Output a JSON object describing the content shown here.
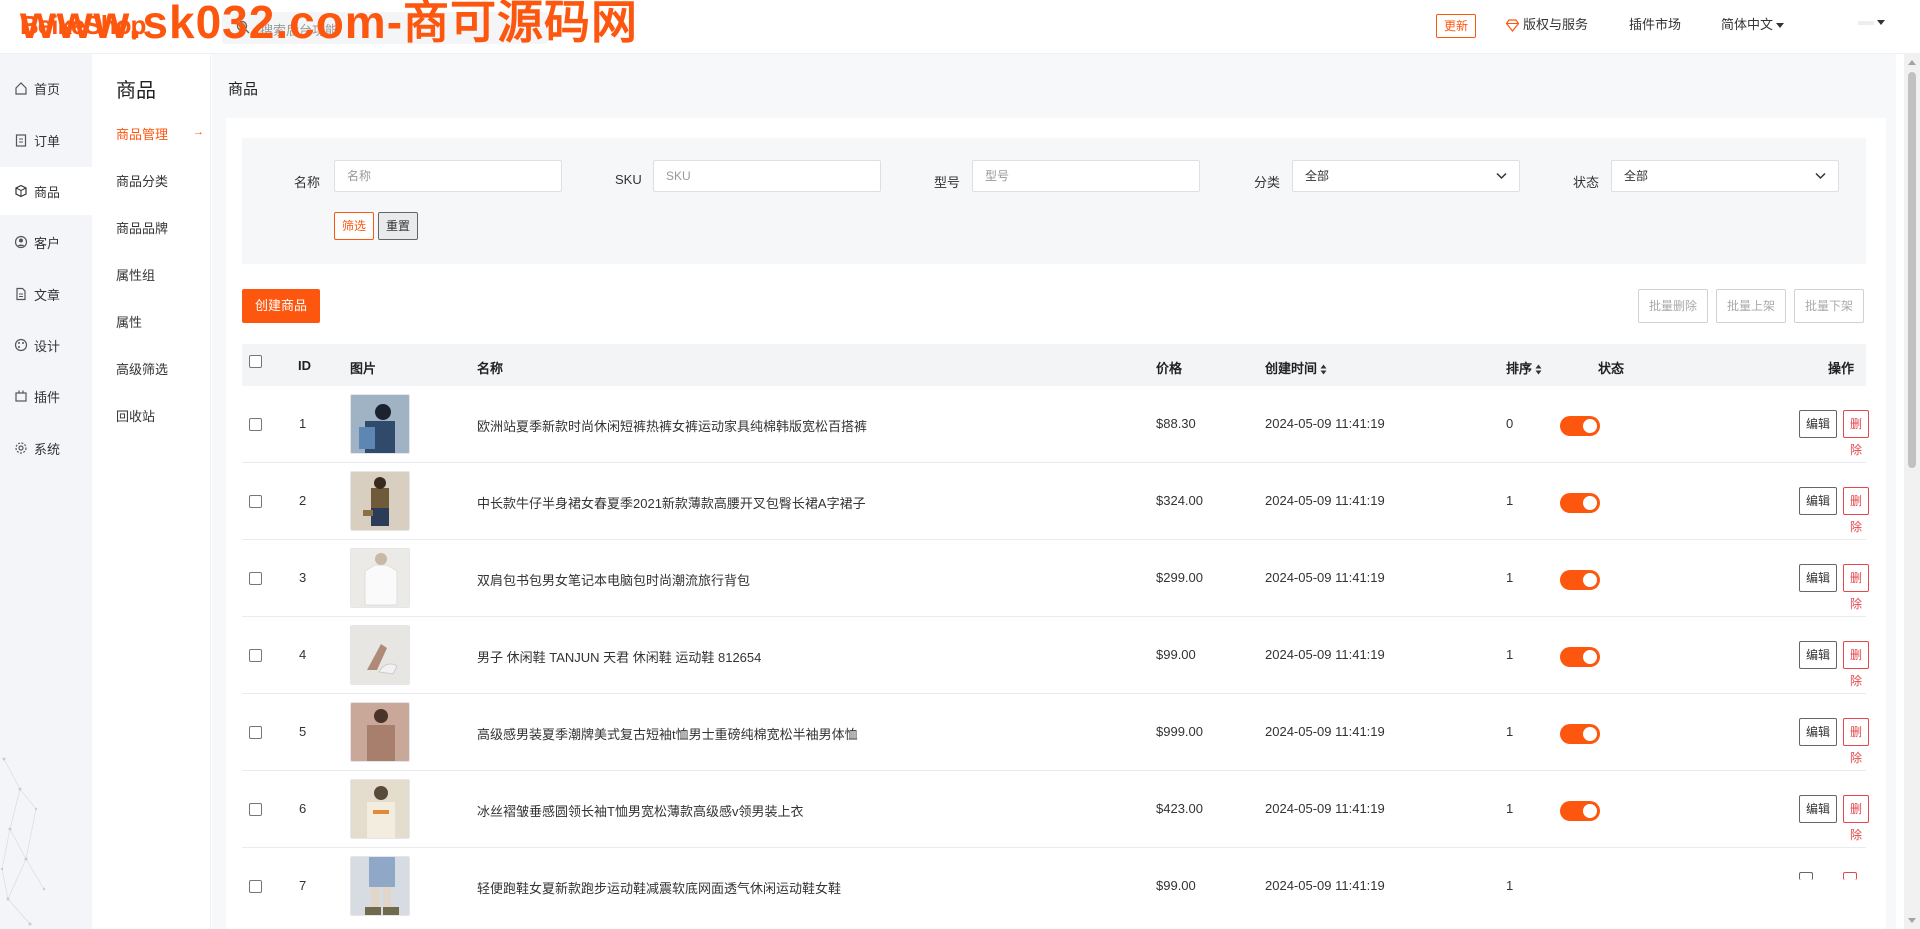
{
  "header": {
    "logo": "BeikeShop",
    "watermark": "www.sk032.com-商可源码网",
    "search_placeholder": "搜索后台功能",
    "update_label": "更新",
    "copyright_label": "版权与服务",
    "plugin_market_label": "插件市场",
    "language_label": "简体中文",
    "brand_color": "#fd560f"
  },
  "sidebar": {
    "items": [
      {
        "label": "首页",
        "icon": "home-icon"
      },
      {
        "label": "订单",
        "icon": "clipboard-icon"
      },
      {
        "label": "商品",
        "icon": "box-icon"
      },
      {
        "label": "客户",
        "icon": "user-circle-icon"
      },
      {
        "label": "文章",
        "icon": "document-icon"
      },
      {
        "label": "设计",
        "icon": "palette-icon"
      },
      {
        "label": "插件",
        "icon": "plugin-icon"
      },
      {
        "label": "系统",
        "icon": "gear-icon"
      }
    ],
    "active": "商品"
  },
  "subnav": {
    "title": "商品",
    "items": [
      "商品管理",
      "商品分类",
      "商品品牌",
      "属性组",
      "属性",
      "高级筛选",
      "回收站"
    ],
    "active": "商品管理",
    "active_arrow": "→"
  },
  "page": {
    "title": "商品",
    "filters": {
      "name_label": "名称",
      "name_placeholder": "名称",
      "sku_label": "SKU",
      "sku_placeholder": "SKU",
      "model_label": "型号",
      "model_placeholder": "型号",
      "category_label": "分类",
      "category_value": "全部",
      "status_label": "状态",
      "status_value": "全部",
      "filter_button": "筛选",
      "reset_button": "重置"
    },
    "create_button": "创建商品",
    "batch_delete": "批量删除",
    "batch_on": "批量上架",
    "batch_off": "批量下架"
  },
  "table": {
    "headers": {
      "id": "ID",
      "image": "图片",
      "name": "名称",
      "price": "价格",
      "created": "创建时间",
      "sort": "排序",
      "status": "状态",
      "actions": "操作"
    },
    "edit_label": "编辑",
    "delete_label": "删除",
    "rows": [
      {
        "id": "1",
        "name": "欧洲站夏季新款时尚休闲短裤热裤女裤运动家具纯棉韩版宽松百搭裤",
        "price": "$88.30",
        "created": "2024-05-09 11:41:19",
        "sort": "0",
        "status": true
      },
      {
        "id": "2",
        "name": "中长款牛仔半身裙女春夏季2021新款薄款高腰开叉包臀长裙A字裙子",
        "price": "$324.00",
        "created": "2024-05-09 11:41:19",
        "sort": "1",
        "status": true
      },
      {
        "id": "3",
        "name": "双肩包书包男女笔记本电脑包时尚潮流旅行背包",
        "price": "$299.00",
        "created": "2024-05-09 11:41:19",
        "sort": "1",
        "status": true
      },
      {
        "id": "4",
        "name": "男子 休闲鞋 TANJUN 天君 休闲鞋 运动鞋 812654",
        "price": "$99.00",
        "created": "2024-05-09 11:41:19",
        "sort": "1",
        "status": true
      },
      {
        "id": "5",
        "name": "高级感男装夏季潮牌美式复古短袖t恤男士重磅纯棉宽松半袖男体恤",
        "price": "$999.00",
        "created": "2024-05-09 11:41:19",
        "sort": "1",
        "status": true
      },
      {
        "id": "6",
        "name": "冰丝褶皱垂感圆领长袖T恤男宽松薄款高级感v领男装上衣",
        "price": "$423.00",
        "created": "2024-05-09 11:41:19",
        "sort": "1",
        "status": true
      },
      {
        "id": "7",
        "name": "轻便跑鞋女夏新款跑步运动鞋减震软底网面透气休闲运动鞋女鞋",
        "price": "$99.00",
        "created": "2024-05-09 11:41:19",
        "sort": "1",
        "status": true
      }
    ]
  }
}
